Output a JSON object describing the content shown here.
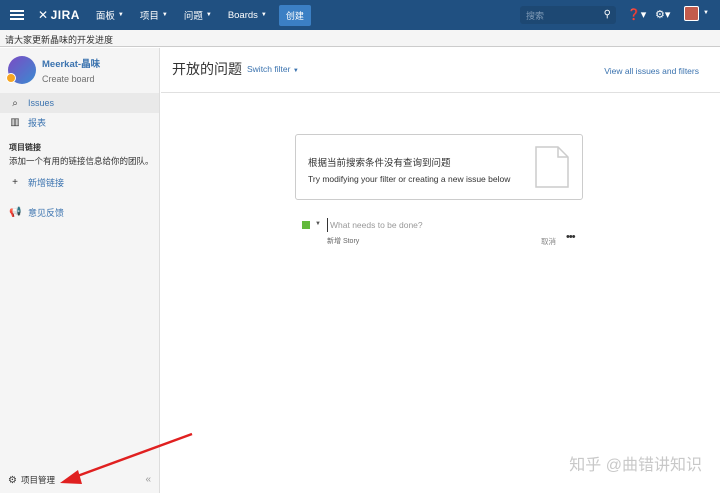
{
  "nav": {
    "logo": "JIRA",
    "items": [
      {
        "label": "面板"
      },
      {
        "label": "项目"
      },
      {
        "label": "问题"
      },
      {
        "label": "Boards"
      }
    ],
    "create_label": "创建",
    "search_placeholder": "搜索"
  },
  "announcement": "请大家更新晶味的开发进度",
  "sidebar": {
    "project_name": "Meerkat-晶味",
    "project_sub": "Create board",
    "items": [
      {
        "label": "Issues"
      },
      {
        "label": "报表"
      }
    ],
    "links_heading": "项目链接",
    "links_desc": "添加一个有用的链接信息给你的团队。",
    "add_link": "新增链接",
    "feedback": "意见反馈",
    "admin": "项目管理"
  },
  "main": {
    "title": "开放的问题",
    "switch_filter": "Switch filter",
    "view_all": "View all issues and filters",
    "empty_title": "根据当前搜索条件没有查询到问题",
    "empty_sub": "Try modifying your filter or creating a new issue below",
    "quick_placeholder": "What needs to be done?",
    "quick_type": "新增 Story",
    "quick_cancel": "取消"
  },
  "watermark": "知乎 @曲错讲知识",
  "colors": {
    "nav_bg": "#205081",
    "create_btn": "#3b7fc4",
    "link": "#3b73af",
    "story_type": "#63ba3c",
    "annotation_arrow": "#e02020"
  }
}
